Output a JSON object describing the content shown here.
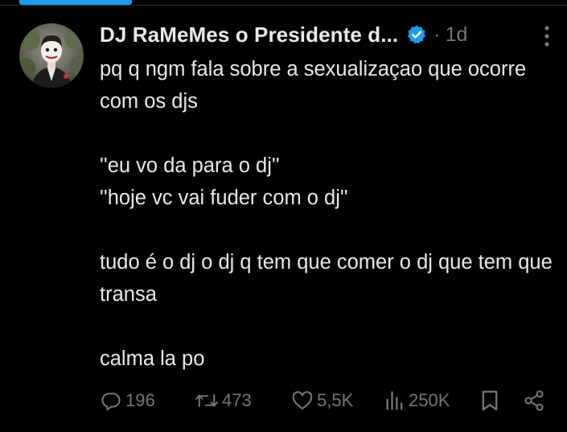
{
  "post": {
    "author_name": "DJ RaMeMes o Presidente d...",
    "separator": "·",
    "time": "1d",
    "paragraphs": [
      "pq q ngm fala sobre a sexualizaçao que ocorre com os djs",
      "''eu vo da para o dj''\n''hoje vc vai fuder com o dj''",
      "tudo é o dj o dj q tem que comer o dj que tem que transa",
      "calma la po"
    ]
  },
  "actions": {
    "replies": "196",
    "reposts": "473",
    "likes": "5,5K",
    "views": "250K"
  },
  "colors": {
    "background": "#000000",
    "text": "#e7e9ea",
    "muted": "#71767b",
    "accent": "#1d9bf0"
  },
  "icons": {
    "verified": "verified-badge-icon",
    "more": "more-vertical-icon",
    "reply": "reply-icon",
    "repost": "repost-icon",
    "like": "heart-icon",
    "views": "views-icon",
    "bookmark": "bookmark-icon",
    "share": "share-icon"
  }
}
